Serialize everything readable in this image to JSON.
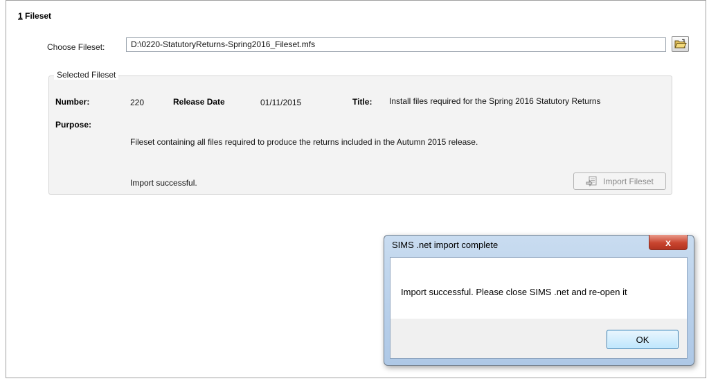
{
  "section": {
    "number": "1",
    "title": "Fileset"
  },
  "choose": {
    "label": "Choose Fileset:",
    "value": "D:\\0220-StatutoryReturns-Spring2016_Fileset.mfs"
  },
  "selected": {
    "legend": "Selected Fileset",
    "number_label": "Number:",
    "number_value": "220",
    "release_label": "Release Date",
    "release_value": "01/11/2015",
    "title_label": "Title:",
    "title_value": "Install files required for the Spring 2016 Statutory Returns",
    "purpose_label": "Purpose:",
    "purpose_value": "Fileset containing all files required to produce the returns included in the Autumn 2015 release.",
    "status": "Import successful.",
    "import_button": "Import Fileset"
  },
  "dialog": {
    "title": "SIMS .net import complete",
    "message": "Import successful. Please close SIMS .net and re-open it",
    "ok": "OK",
    "close_symbol": "x"
  },
  "icons": {
    "browse": "folder-open-icon",
    "import": "import-document-icon",
    "close": "close-icon"
  },
  "colors": {
    "dialog_frame": "#b7cfea",
    "close_button": "#c9452f",
    "ok_border": "#3c7fb1"
  }
}
